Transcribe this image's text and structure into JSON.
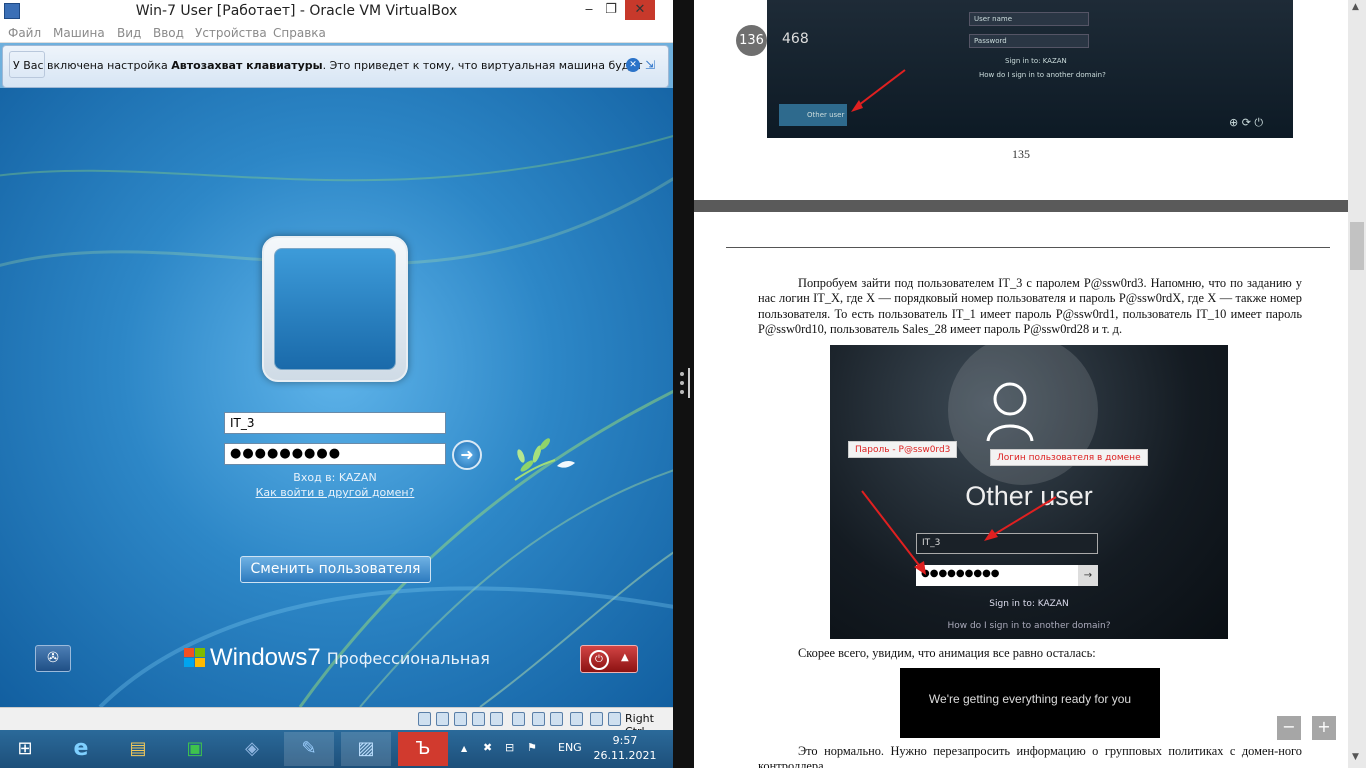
{
  "vbox": {
    "title": "Win-7 User [Работает] - Oracle VM VirtualBox",
    "min_glyph": "‒",
    "max_glyph": "❐",
    "close_glyph": "✕",
    "menu": [
      "Файл",
      "Машина",
      "Вид",
      "Ввод",
      "Устройства",
      "Справка"
    ],
    "notice_prefix": "У Вас включена настройка ",
    "notice_bold": "Автозахват клавиатуры",
    "notice_suffix": ". Это приведет к тому, что виртуальная машина будет",
    "host_key": "Right Ctrl"
  },
  "login": {
    "username": "IT_3",
    "password_mask": "●●●●●●●●●",
    "go_glyph": "➜",
    "domain_label": "Вход в: KAZAN",
    "domain_link": "Как войти в другой домен?",
    "switch_user": "Сменить пользователя",
    "brand_windows": "Windows",
    "brand_version": "7",
    "edition": "Профессиональная",
    "ease_glyph": "✇",
    "power_glyph": "⏻",
    "power_arrow": "▲"
  },
  "taskbar": {
    "icons": [
      "start-icon",
      "ie-icon",
      "explorer-icon",
      "store-icon",
      "virtualbox-icon",
      "vm-window-icon",
      "image-viewer-icon",
      "pdf-reader-icon"
    ],
    "glyphs": [
      "⊞",
      "e",
      "▤",
      "▣",
      "◈",
      "✎",
      "▨",
      "Ъ"
    ],
    "language": "ENG",
    "time": "9:57",
    "date": "26.11.2021",
    "tray_up": "▲",
    "tray_sound": "✖",
    "tray_net": "⊟",
    "tray_flag": "⚑"
  },
  "reader": {
    "page_badge": "136",
    "page_total": "468",
    "page_number": "135",
    "shot1": {
      "user_name_placeholder": "User name",
      "password_placeholder": "Password",
      "sign_in": "Sign in to: KAZAN",
      "how": "How do I sign in to another domain?",
      "other_user": "Other user"
    },
    "para1": "Попробуем зайти под пользователем IT_3 с паролем P@ssw0rd3. Напомню, что по заданию у нас логин IT_X, где X — порядковый номер пользователя и пароль P@ssw0rdX, где X — также номер пользователя. То есть пользователь IT_1 имеет пароль P@ssw0rd1, пользователь IT_10 имеет пароль P@ssw0rd10, пользователь Sales_28 имеет пароль P@ssw0rd28 и т. д.",
    "shot2": {
      "callout_password": "Пароль - P@ssw0rd3",
      "callout_login": "Логин пользователя в домене",
      "other_user": "Other user",
      "username": "IT_3",
      "password_mask": "●●●●●●●●●",
      "sign_in": "Sign in to: KAZAN",
      "how": "How do I sign in to another domain?"
    },
    "para2": "Скорее всего, увидим, что анимация все равно осталась:",
    "shot3_text": "We're getting everything ready for you",
    "para3": "Это нормально. Нужно перезапросить информацию о групповых политиках с домен-ного контроллера.",
    "zoom_out": "−",
    "zoom_in": "+"
  },
  "colors": {
    "close_red": "#c7392b",
    "win7_blue": "#2d87c7",
    "power_red": "#b32020",
    "callout_red": "#dd2222"
  }
}
